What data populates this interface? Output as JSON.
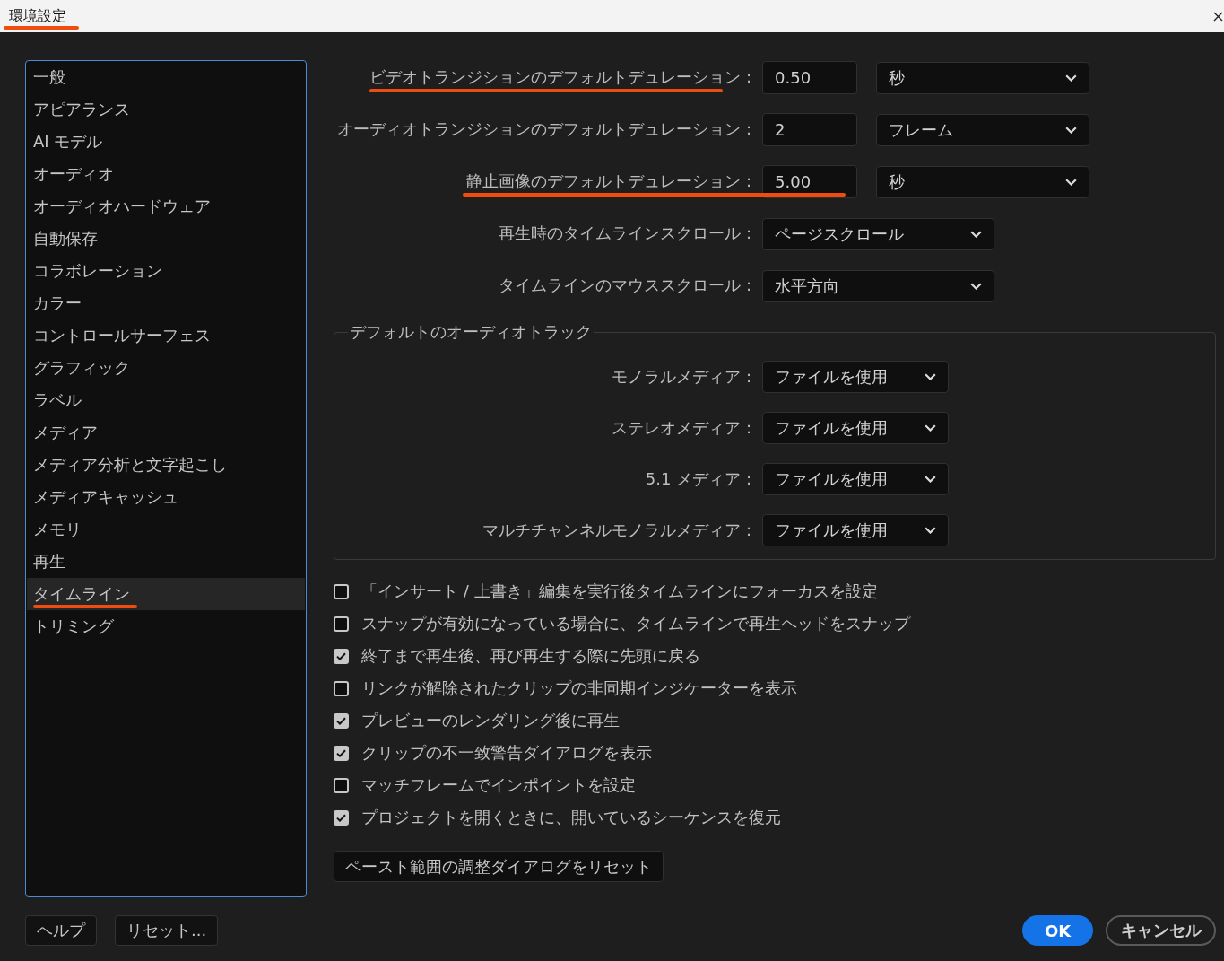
{
  "window": {
    "title": "環境設定",
    "title_underlined": true
  },
  "sidebar": {
    "items": [
      {
        "label": "一般",
        "selected": false,
        "underlined": false
      },
      {
        "label": "アピアランス",
        "selected": false,
        "underlined": false
      },
      {
        "label": "AI モデル",
        "selected": false,
        "underlined": false
      },
      {
        "label": "オーディオ",
        "selected": false,
        "underlined": false
      },
      {
        "label": "オーディオハードウェア",
        "selected": false,
        "underlined": false
      },
      {
        "label": "自動保存",
        "selected": false,
        "underlined": false
      },
      {
        "label": "コラボレーション",
        "selected": false,
        "underlined": false
      },
      {
        "label": "カラー",
        "selected": false,
        "underlined": false
      },
      {
        "label": "コントロールサーフェス",
        "selected": false,
        "underlined": false
      },
      {
        "label": "グラフィック",
        "selected": false,
        "underlined": false
      },
      {
        "label": "ラベル",
        "selected": false,
        "underlined": false
      },
      {
        "label": "メディア",
        "selected": false,
        "underlined": false
      },
      {
        "label": "メディア分析と文字起こし",
        "selected": false,
        "underlined": false
      },
      {
        "label": "メディアキャッシュ",
        "selected": false,
        "underlined": false
      },
      {
        "label": "メモリ",
        "selected": false,
        "underlined": false
      },
      {
        "label": "再生",
        "selected": false,
        "underlined": false
      },
      {
        "label": "タイムライン",
        "selected": true,
        "underlined": true
      },
      {
        "label": "トリミング",
        "selected": false,
        "underlined": false
      }
    ]
  },
  "timeline_settings": [
    {
      "kind": "field_and_select",
      "label": "ビデオトランジションのデフォルトデュレーション :",
      "value": "0.50",
      "unit": "秒",
      "underlined": true,
      "underline_through_field": false
    },
    {
      "kind": "field_and_select",
      "label": "オーディオトランジションのデフォルトデュレーション :",
      "value": "2",
      "unit": "フレーム",
      "underlined": false
    },
    {
      "kind": "field_and_select",
      "label": "静止画像のデフォルトデュレーション :",
      "value": "5.00",
      "unit": "秒",
      "underlined": true,
      "underline_through_field": true
    },
    {
      "kind": "select",
      "label": "再生時のタイムラインスクロール :",
      "value": "ページスクロール",
      "underlined": false
    },
    {
      "kind": "select",
      "label": "タイムラインのマウススクロール :",
      "value": "水平方向",
      "underlined": false
    }
  ],
  "audio_tracks": {
    "title": "デフォルトのオーディオトラック",
    "rows": [
      {
        "label": "モノラルメディア :",
        "value": "ファイルを使用"
      },
      {
        "label": "ステレオメディア :",
        "value": "ファイルを使用"
      },
      {
        "label": "5.1 メディア :",
        "value": "ファイルを使用"
      },
      {
        "label": "マルチチャンネルモノラルメディア :",
        "value": "ファイルを使用"
      }
    ]
  },
  "options": [
    {
      "label": "「インサート / 上書き」編集を実行後タイムラインにフォーカスを設定",
      "checked": false
    },
    {
      "label": "スナップが有効になっている場合に、タイムラインで再生ヘッドをスナップ",
      "checked": false
    },
    {
      "label": "終了まで再生後、再び再生する際に先頭に戻る",
      "checked": true
    },
    {
      "label": "リンクが解除されたクリップの非同期インジケーターを表示",
      "checked": false
    },
    {
      "label": "プレビューのレンダリング後に再生",
      "checked": true
    },
    {
      "label": "クリップの不一致警告ダイアログを表示",
      "checked": true
    },
    {
      "label": "マッチフレームでインポイントを設定",
      "checked": false
    },
    {
      "label": "プロジェクトを開くときに、開いているシーケンスを復元",
      "checked": true
    }
  ],
  "reset_dialogs_button": "ペースト範囲の調整ダイアログをリセット",
  "footer": {
    "help_button": "ヘルプ",
    "reset_button": "リセット...",
    "ok_button": "OK",
    "cancel_button": "キャンセル"
  }
}
